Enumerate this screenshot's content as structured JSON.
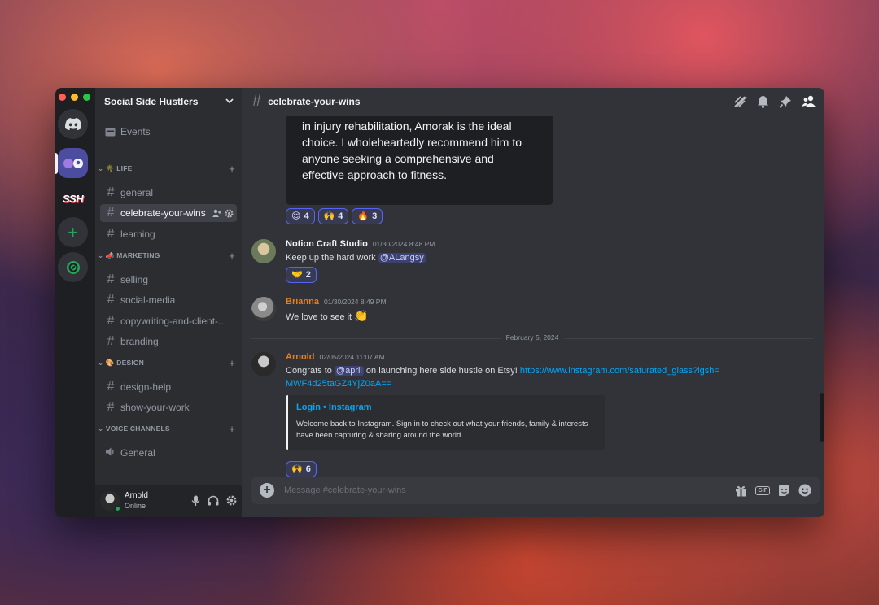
{
  "server": {
    "name": "Social Side Hustlers",
    "rail_ssh_label": "SSH"
  },
  "sidebar": {
    "events_label": "Events",
    "categories": [
      {
        "label": "🌴 LIFE",
        "channels": [
          "general",
          "celebrate-your-wins",
          "learning"
        ]
      },
      {
        "label": "📣 MARKETING",
        "channels": [
          "selling",
          "social-media",
          "copywriting-and-client-...",
          "branding"
        ]
      },
      {
        "label": "🎨 DESIGN",
        "channels": [
          "design-help",
          "show-your-work"
        ]
      },
      {
        "label": "VOICE CHANNELS",
        "channels": [
          "General"
        ]
      }
    ],
    "active_channel": "celebrate-your-wins"
  },
  "user": {
    "name": "Arnold",
    "status": "Online"
  },
  "topbar": {
    "channel": "celebrate-your-wins"
  },
  "messages": {
    "image_text": "in injury rehabilitation, Amorak is the ideal choice. I wholeheartedly recommend him to anyone seeking a comprehensive and effective approach to fitness.",
    "image_reactions": [
      {
        "emoji": "😌",
        "count": "4"
      },
      {
        "emoji": "🙌",
        "count": "4"
      },
      {
        "emoji": "🔥",
        "count": "3"
      }
    ],
    "m1": {
      "author": "Notion Craft Studio",
      "time": "01/30/2024 8:48 PM",
      "text": "Keep up the hard work ",
      "mention": "@ALangsy",
      "reaction": {
        "emoji": "🤝",
        "count": "2"
      }
    },
    "m2": {
      "author": "Brianna",
      "time": "01/30/2024 8:49 PM",
      "text": "We love to see it ",
      "emoji": "👏"
    },
    "divider": "February 5, 2024",
    "m3": {
      "author": "Arnold",
      "time": "02/05/2024 11:07 AM",
      "text_before": "Congrats to ",
      "mention": "@april",
      "text_after": " on launching here side hustle on Etsy! ",
      "link": "https://www.instagram.com/saturated_glass?igsh=MWF4d25taGZ4YjZ0aA==",
      "embed_title": "Login • Instagram",
      "embed_desc": "Welcome back to Instagram. Sign in to check out what your friends, family & interests have been capturing & sharing around the world.",
      "reaction": {
        "emoji": "🙌",
        "count": "6"
      }
    }
  },
  "composer": {
    "placeholder": "Message #celebrate-your-wins",
    "gif_label": "GIF"
  },
  "colors": {
    "accent": "#5865f2",
    "online": "#23a55a",
    "link": "#00a8fc",
    "author_orange": "#e67e22"
  }
}
